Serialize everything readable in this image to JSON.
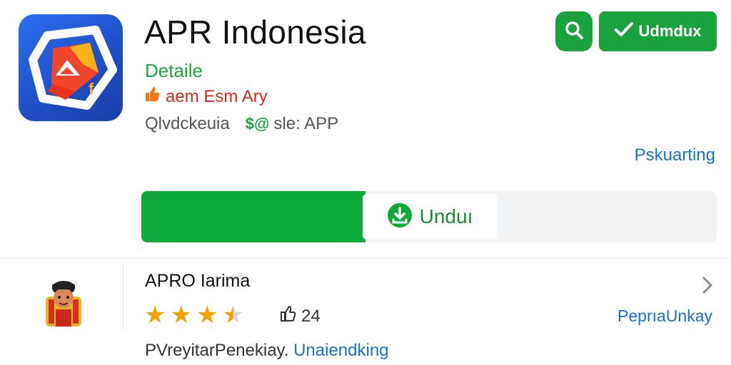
{
  "app": {
    "title": "APR Indonesia",
    "details_label": "Detaile",
    "rating_text": "aem Esm Ary",
    "developer": "Qlvdckeuia",
    "size_badge_icon": "$@",
    "size_text": "sle: APP",
    "more_link": "Pskuarting"
  },
  "header": {
    "install_label": "Udmdux"
  },
  "download": {
    "label": "Unduı",
    "progress": 0.39
  },
  "review": {
    "title": "APRO Iarima",
    "rating": 3.5,
    "likes": "24",
    "link": "PeprıaUnkay",
    "footer_text": "PVreyitarPenekiay.",
    "footer_link": "Unaiendking"
  },
  "colors": {
    "accent_green": "#1aa33c",
    "link_blue": "#1a6fd1",
    "star": "#f0a400"
  },
  "icons": [
    "app-logo-icon",
    "thumb-icon",
    "search-icon",
    "check-icon",
    "download-icon",
    "like-icon",
    "chevron-right-icon"
  ]
}
